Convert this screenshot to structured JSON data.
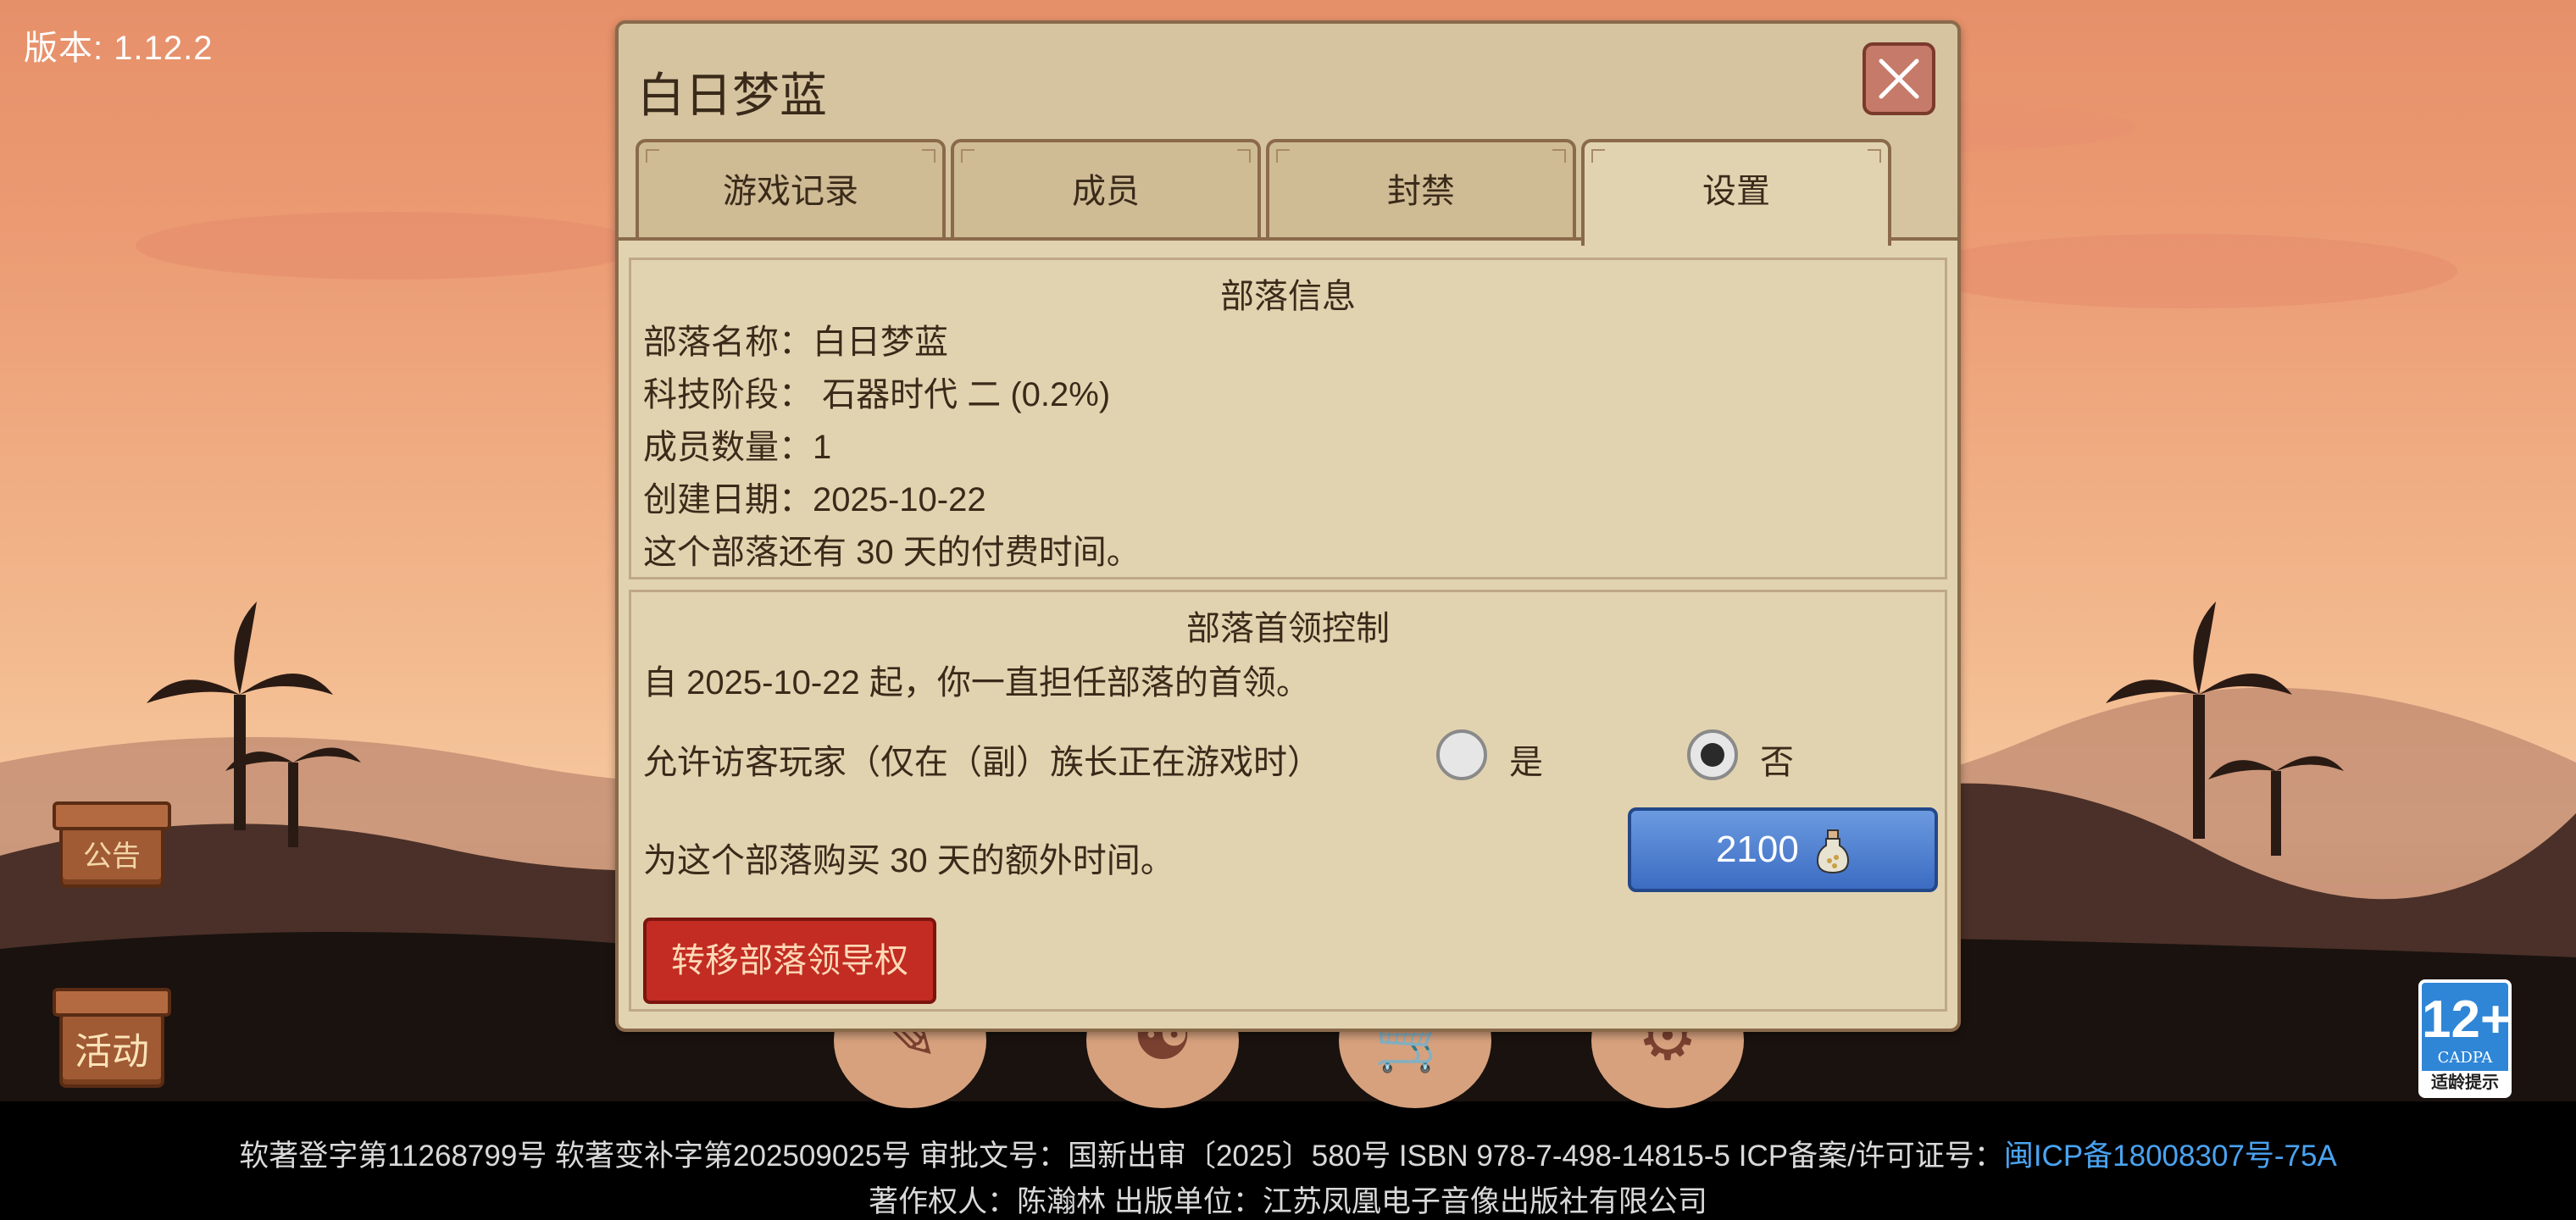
{
  "version_label": "版本: 1.12.2",
  "side_buttons": {
    "notice": "公告",
    "activity": "活动"
  },
  "dialog": {
    "title": "白日梦蓝",
    "tabs": [
      "游戏记录",
      "成员",
      "封禁",
      "设置"
    ],
    "active_tab": "设置",
    "tribe_info": {
      "heading": "部落信息",
      "name_line": "部落名称：白日梦蓝",
      "tech_line": "科技阶段： 石器时代 二 (0.2%)",
      "members_line": "成员数量：1",
      "created_line": "创建日期：2025-10-22",
      "paid_line": "这个部落还有 30 天的付费时间。"
    },
    "leader_control": {
      "heading": "部落首领控制",
      "leader_since": "自 2025-10-22 起，你一直担任部落的首领。",
      "visitor_label": "允许访客玩家（仅在（副）族长正在游戏时）",
      "option_yes": "是",
      "option_no": "否",
      "selected_option": "否",
      "buy_time_label": "为这个部落购买 30 天的额外时间。",
      "buy_price": "2100",
      "transfer_button": "转移部落领导权"
    }
  },
  "age_rating": {
    "number": "12+",
    "org": "CADPA",
    "tip": "适龄提示"
  },
  "footer": {
    "line1": "软著登字第11268799号 软著变补字第202509025号 审批文号：国新出审〔2025〕580号 ISBN 978-7-498-14815-5 ICP备案/许可证号：",
    "icp_link": "闽ICP备18008307号-75A",
    "line2": "著作权人：陈瀚林 出版单位：江苏凤凰电子音像出版社有限公司"
  },
  "colors": {
    "dialog_bg": "#d6c4a0",
    "panel_bg": "#e2d3b0",
    "buy_button": "#3c6cc2",
    "transfer_button": "#c22c22",
    "link": "#4aa3f0"
  }
}
